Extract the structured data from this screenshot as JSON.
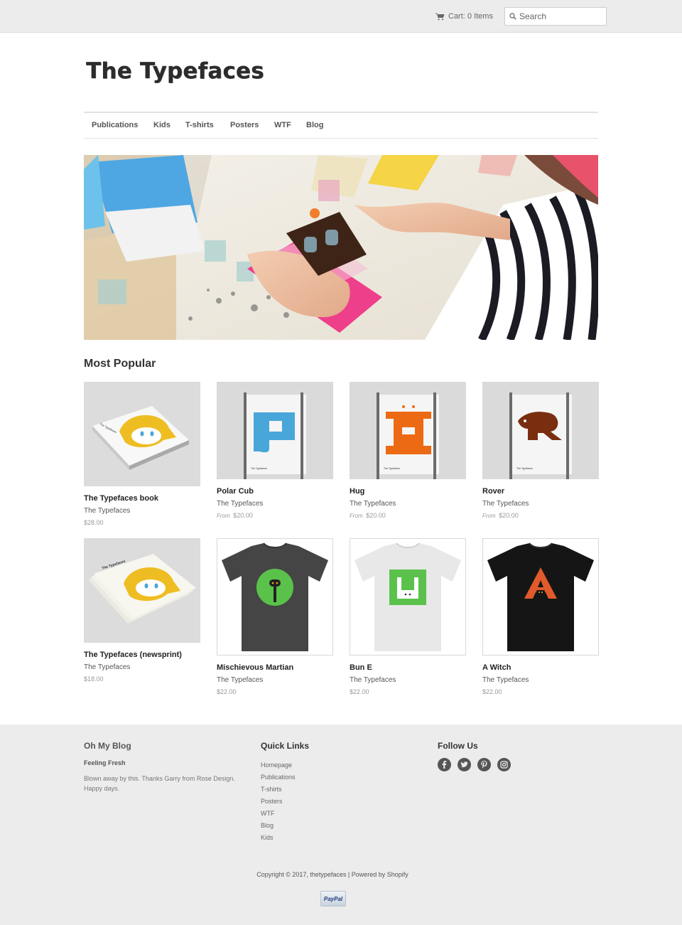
{
  "topbar": {
    "cart_label": "Cart: 0 Items",
    "search_placeholder": "Search"
  },
  "site": {
    "logo_text": "The Typefaces"
  },
  "nav": {
    "items": [
      "Publications",
      "Kids",
      "T-shirts",
      "Posters",
      "WTF",
      "Blog"
    ]
  },
  "section_title": "Most Popular",
  "products": [
    {
      "name": "The Typefaces book",
      "vendor": "The Typefaces",
      "from": "",
      "price": "$28.00"
    },
    {
      "name": "Polar Cub",
      "vendor": "The Typefaces",
      "from": "From",
      "price": "$20.00"
    },
    {
      "name": "Hug",
      "vendor": "The Typefaces",
      "from": "From",
      "price": "$20.00"
    },
    {
      "name": "Rover",
      "vendor": "The Typefaces",
      "from": "From",
      "price": "$20.00"
    },
    {
      "name": "The Typefaces (newsprint)",
      "vendor": "The Typefaces",
      "from": "",
      "price": "$18.00"
    },
    {
      "name": "Mischievous Martian",
      "vendor": "The Typefaces",
      "from": "",
      "price": "$22.00"
    },
    {
      "name": "Bun E",
      "vendor": "The Typefaces",
      "from": "",
      "price": "$22.00"
    },
    {
      "name": "A Witch",
      "vendor": "The Typefaces",
      "from": "",
      "price": "$22.00"
    }
  ],
  "footer": {
    "blog": {
      "heading": "Oh My Blog",
      "post_title": "Feeling Fresh",
      "post_body": "Blown away by this. Thanks Garry from Rose Design. Happy days."
    },
    "quick_links": {
      "heading": "Quick Links",
      "items": [
        "Homepage",
        "Publications",
        "T-shirts",
        "Posters",
        "WTF",
        "Blog",
        "Kids"
      ]
    },
    "follow": {
      "heading": "Follow Us",
      "icons": [
        "facebook-icon",
        "twitter-icon",
        "pinterest-icon",
        "instagram-icon"
      ]
    },
    "copyright": "Copyright © 2017, thetypefaces | Powered by Shopify",
    "paypal_label": "PayPal"
  },
  "colors": {
    "topbar_bg": "#ececec",
    "footer_bg": "#ececec",
    "text": "#333333"
  }
}
